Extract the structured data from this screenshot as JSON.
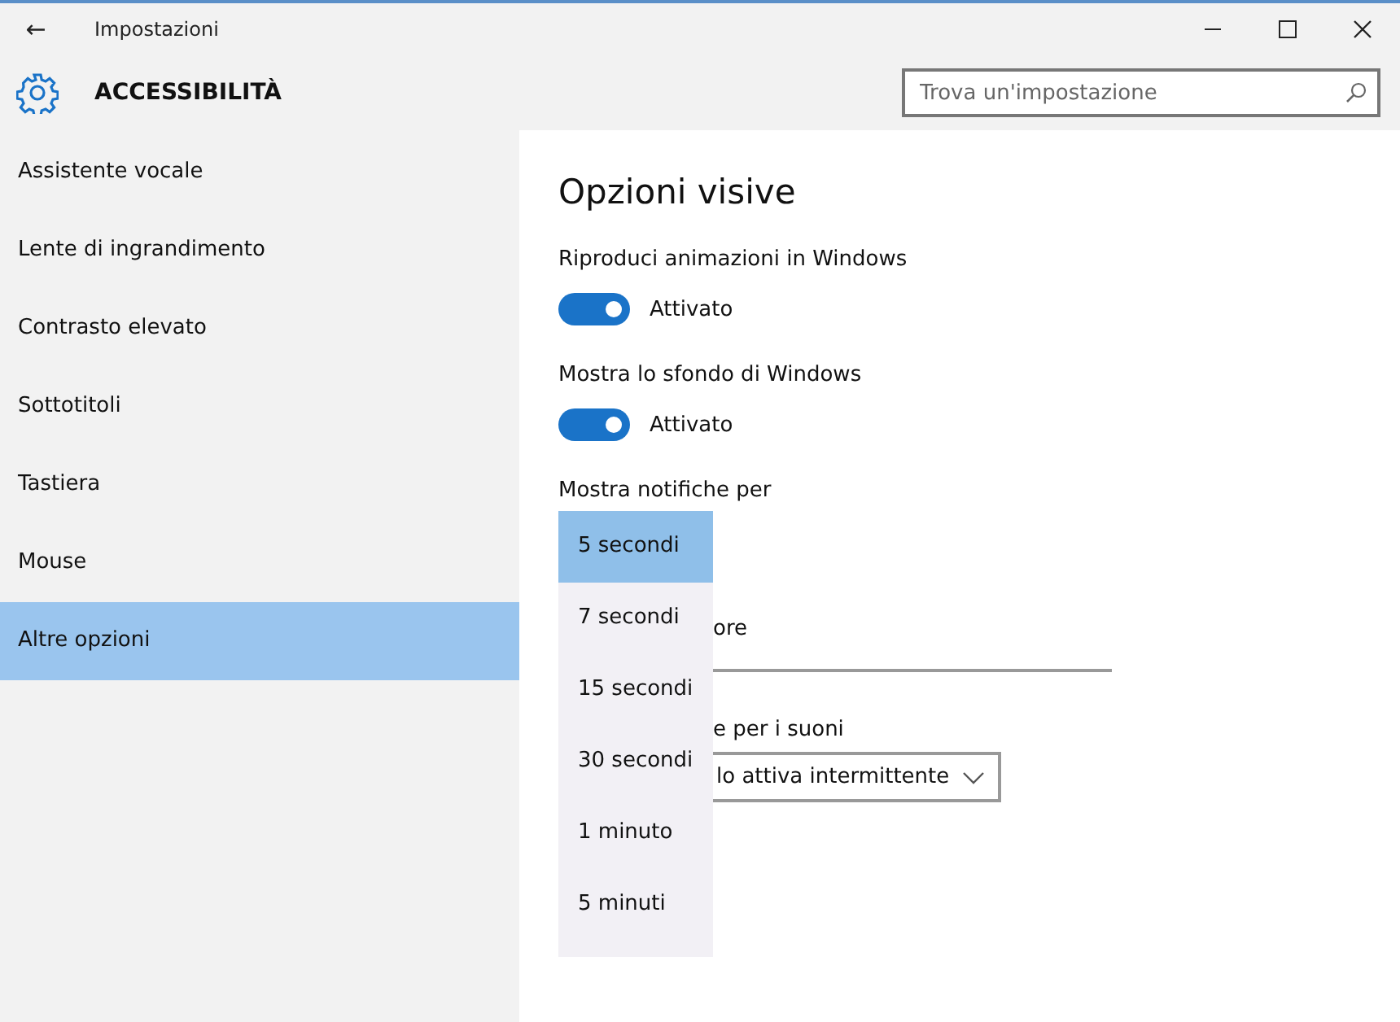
{
  "window": {
    "title": "Impostazioni",
    "back": "←"
  },
  "header": {
    "title": "ACCESSIBILITÀ",
    "search": {
      "placeholder": "Trova un'impostazione"
    }
  },
  "sidebar": {
    "items": [
      {
        "label": "Assistente vocale",
        "selected": false
      },
      {
        "label": "Lente di ingrandimento",
        "selected": false
      },
      {
        "label": "Contrasto elevato",
        "selected": false
      },
      {
        "label": "Sottotitoli",
        "selected": false
      },
      {
        "label": "Tastiera",
        "selected": false
      },
      {
        "label": "Mouse",
        "selected": false
      },
      {
        "label": "Altre opzioni",
        "selected": true
      }
    ]
  },
  "content": {
    "title": "Opzioni visive",
    "toggles": [
      {
        "label": "Riproduci animazioni in Windows",
        "on": true,
        "state": "Attivato"
      },
      {
        "label": "Mostra lo sfondo di Windows",
        "on": true,
        "state": "Attivato"
      }
    ],
    "notifications_label": "Mostra notifiche per",
    "hidden_label_1": "ore",
    "hidden_label_2": "e per i suoni",
    "hidden_dropdown_value": "lo attiva intermittente",
    "popup": [
      {
        "label": "5 secondi",
        "selected": true
      },
      {
        "label": "7 secondi",
        "selected": false
      },
      {
        "label": "15 secondi",
        "selected": false
      },
      {
        "label": "30 secondi",
        "selected": false
      },
      {
        "label": "1 minuto",
        "selected": false
      },
      {
        "label": "5 minuti",
        "selected": false
      }
    ]
  }
}
